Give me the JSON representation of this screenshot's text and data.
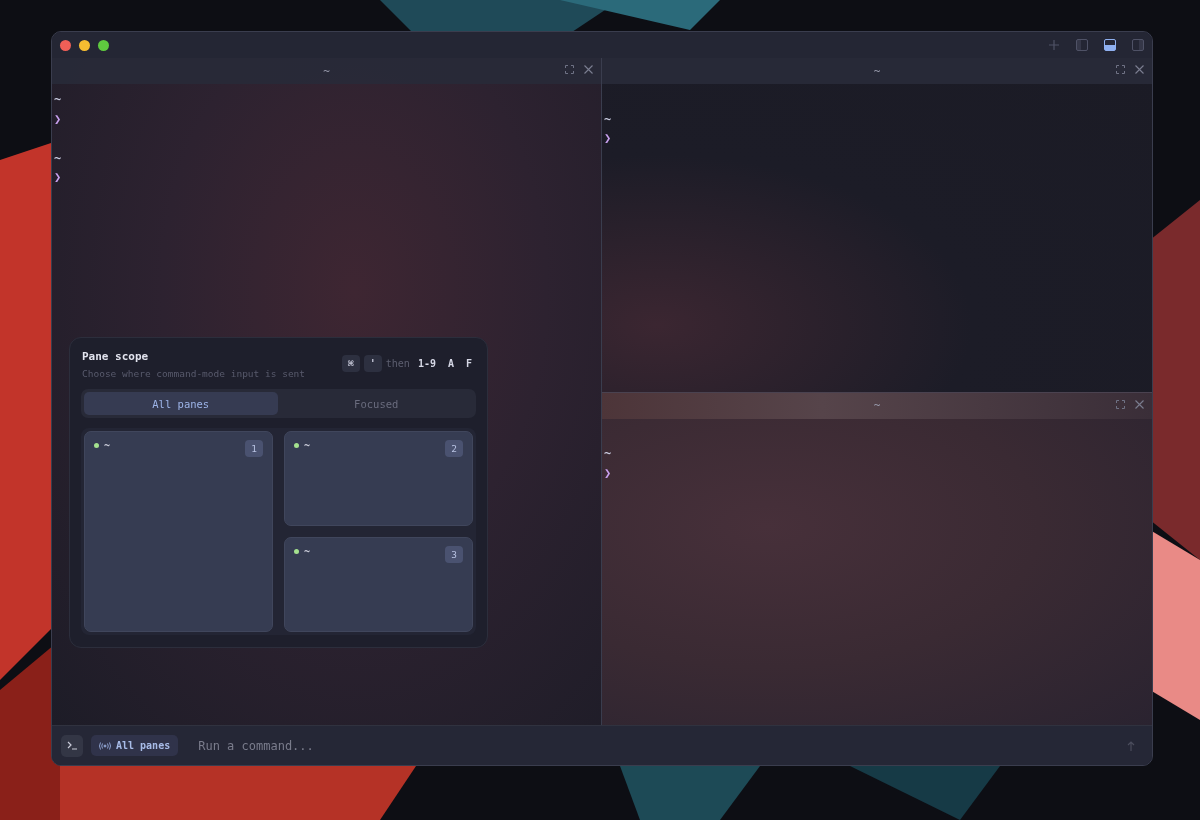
{
  "window": {
    "layout_buttons": [
      {
        "selected": false
      },
      {
        "selected": true
      },
      {
        "selected": false
      }
    ]
  },
  "panes": [
    {
      "title": "~",
      "blocks": [
        {
          "cwd": "~",
          "prompt": "❯"
        },
        {
          "cwd": "~",
          "prompt": "❯"
        }
      ]
    },
    {
      "title": "~",
      "blocks": [
        {
          "cwd": "~",
          "prompt": "❯"
        }
      ]
    },
    {
      "title": "~",
      "blocks": [
        {
          "cwd": "~",
          "prompt": "❯"
        }
      ]
    }
  ],
  "scope_popup": {
    "title": "Pane scope",
    "subtitle": "Choose where command-mode input is sent",
    "modifier_keys": [
      "⌘",
      "'"
    ],
    "then": "then",
    "target_keys": [
      "1-9",
      "A",
      "F"
    ],
    "options": [
      {
        "label": "All panes",
        "selected": true
      },
      {
        "label": "Focused",
        "selected": false
      }
    ],
    "pane_map": [
      {
        "label": "~",
        "number": "1"
      },
      {
        "label": "~",
        "number": "2"
      },
      {
        "label": "~",
        "number": "3"
      }
    ]
  },
  "command_bar": {
    "scope": "All panes",
    "placeholder": "Run a command..."
  }
}
